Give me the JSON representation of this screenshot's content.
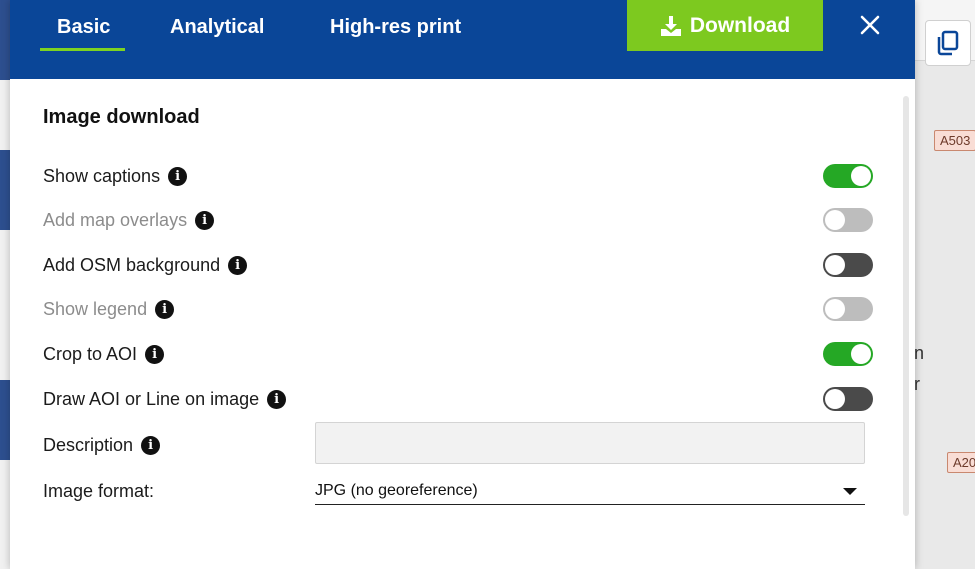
{
  "tabs": [
    {
      "label": "Basic",
      "active": true
    },
    {
      "label": "Analytical",
      "active": false
    },
    {
      "label": "High-res print",
      "active": false
    }
  ],
  "header": {
    "download_label": "Download",
    "download_icon": "download-icon",
    "close_icon": "close-icon"
  },
  "section_title": "Image download",
  "options": [
    {
      "label": "Show captions",
      "state": "on",
      "enabled": true
    },
    {
      "label": "Add map overlays",
      "state": "off",
      "enabled": false
    },
    {
      "label": "Add OSM background",
      "state": "off",
      "enabled": true
    },
    {
      "label": "Show legend",
      "state": "off",
      "enabled": false
    },
    {
      "label": "Crop to AOI",
      "state": "on",
      "enabled": true
    },
    {
      "label": "Draw AOI or Line on image",
      "state": "off",
      "enabled": true
    }
  ],
  "description": {
    "label": "Description",
    "value": ""
  },
  "image_format": {
    "label": "Image format:",
    "selected": "JPG (no georeference)"
  },
  "background": {
    "chip_1": "A503",
    "chip_2": "A20",
    "edge_text_1": "n",
    "edge_text_2": "r"
  },
  "colors": {
    "header": "#0a4698",
    "download": "#7dc91f",
    "toggle_on": "#25a825",
    "toggle_off": "#4a4a4a",
    "toggle_disabled": "#bdbdbd"
  }
}
